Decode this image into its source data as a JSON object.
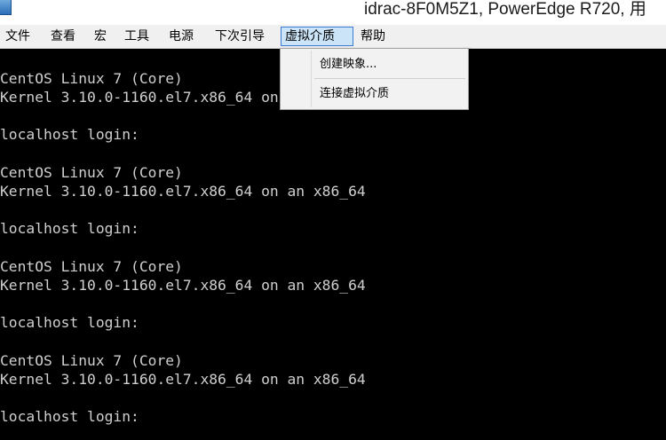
{
  "window": {
    "title": "idrac-8F0M5Z1, PowerEdge R720, 用"
  },
  "menubar": {
    "items": [
      {
        "label": "文件"
      },
      {
        "label": "查看"
      },
      {
        "label": "宏"
      },
      {
        "label": "工具"
      },
      {
        "label": "电源"
      },
      {
        "label": "下次引导"
      },
      {
        "label": "虚拟介质"
      },
      {
        "label": "帮助"
      }
    ],
    "active": "虚拟介质"
  },
  "dropdown": {
    "items": [
      {
        "label": "创建映象..."
      },
      {
        "label": "连接虚拟介质"
      }
    ]
  },
  "terminal": {
    "lines": [
      "CentOS Linux 7 (Core)",
      "Kernel 3.10.0-1160.el7.x86_64 on an x86_64",
      "localhost login:",
      "CentOS Linux 7 (Core)",
      "Kernel 3.10.0-1160.el7.x86_64 on an x86_64",
      "localhost login:",
      "CentOS Linux 7 (Core)",
      "Kernel 3.10.0-1160.el7.x86_64 on an x86_64",
      "localhost login:",
      "CentOS Linux 7 (Core)",
      "Kernel 3.10.0-1160.el7.x86_64 on an x86_64",
      "localhost login:"
    ]
  },
  "colors": {
    "terminal_bg": "#000000",
    "terminal_fg": "#cfcfcf",
    "menu_highlight": "#cce4f7",
    "menu_highlight_border": "#3a7bd5"
  }
}
